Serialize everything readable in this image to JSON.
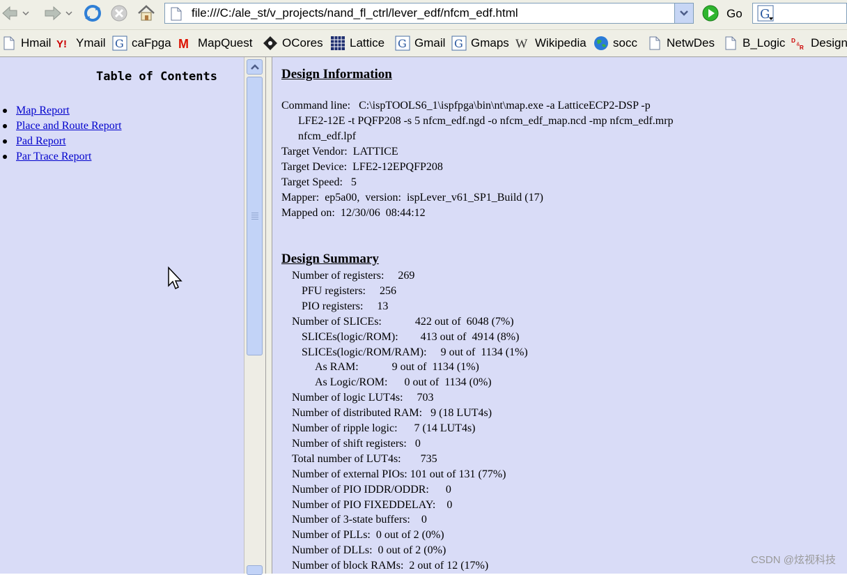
{
  "toolbar": {
    "address": "file:///C:/ale_st/v_projects/nand_fl_ctrl/lever_edf/nfcm_edf.html",
    "go_label": "Go",
    "icons": [
      "back-icon",
      "forward-icon",
      "reload-icon",
      "stop-icon",
      "home-icon",
      "page-icon",
      "go-icon",
      "google-search-icon"
    ]
  },
  "bookmarks": [
    {
      "label": "Hmail",
      "icon": "page-icon"
    },
    {
      "label": "Ymail",
      "icon": "yahoo-icon"
    },
    {
      "label": "caFpga",
      "icon": "google-icon"
    },
    {
      "label": "MapQuest",
      "icon": "mapquest-icon"
    },
    {
      "label": "OCores",
      "icon": "opencores-icon"
    },
    {
      "label": "Lattice",
      "icon": "lattice-icon"
    },
    {
      "label": "Gmail",
      "icon": "google-icon"
    },
    {
      "label": "Gmaps",
      "icon": "google-icon"
    },
    {
      "label": "Wikipedia",
      "icon": "wikipedia-icon"
    },
    {
      "label": "socc",
      "icon": "globe-icon"
    },
    {
      "label": "NetwDes",
      "icon": "page-icon"
    },
    {
      "label": "B_Logic",
      "icon": "page-icon"
    },
    {
      "label": "Design",
      "icon": "dr-icon"
    }
  ],
  "toc": {
    "title": "Table of Contents",
    "items": [
      "Map Report",
      "Place and Route Report",
      "Pad Report",
      "Par Trace Report"
    ]
  },
  "design_info": {
    "heading": "Design Information",
    "command_line": [
      "Command line:   C:\\ispTOOLS6_1\\ispfpga\\bin\\nt\\map.exe -a LatticeECP2-DSP -p",
      "LFE2-12E -t PQFP208 -s 5 nfcm_edf.ngd -o nfcm_edf_map.ncd -mp nfcm_edf.mrp",
      "nfcm_edf.lpf"
    ],
    "lines": [
      "Target Vendor:  LATTICE",
      "Target Device:  LFE2-12EPQFP208",
      "Target Speed:   5",
      "Mapper:  ep5a00,  version:  ispLever_v61_SP1_Build (17)",
      "Mapped on:  12/30/06  08:44:12"
    ]
  },
  "design_summary": {
    "heading": "Design Summary",
    "rows": [
      {
        "indent": 0,
        "text": "Number of registers:     269"
      },
      {
        "indent": 1,
        "text": "PFU registers:     256"
      },
      {
        "indent": 1,
        "text": "PIO registers:     13"
      },
      {
        "indent": 0,
        "text": "Number of SLICEs:            422 out of  6048 (7%)"
      },
      {
        "indent": 1,
        "text": "SLICEs(logic/ROM):        413 out of  4914 (8%)"
      },
      {
        "indent": 1,
        "text": "SLICEs(logic/ROM/RAM):     9 out of  1134 (1%)"
      },
      {
        "indent": 2,
        "text": "As RAM:            9 out of  1134 (1%)"
      },
      {
        "indent": 2,
        "text": "As Logic/ROM:      0 out of  1134 (0%)"
      },
      {
        "indent": 0,
        "text": "Number of logic LUT4s:     703"
      },
      {
        "indent": 0,
        "text": "Number of distributed RAM:   9 (18 LUT4s)"
      },
      {
        "indent": 0,
        "text": "Number of ripple logic:      7 (14 LUT4s)"
      },
      {
        "indent": 0,
        "text": "Number of shift registers:   0"
      },
      {
        "indent": 0,
        "text": "Total number of LUT4s:       735"
      },
      {
        "indent": 0,
        "text": "Number of external PIOs: 101 out of 131 (77%)"
      },
      {
        "indent": 0,
        "text": "Number of PIO IDDR/ODDR:      0"
      },
      {
        "indent": 0,
        "text": "Number of PIO FIXEDDELAY:    0"
      },
      {
        "indent": 0,
        "text": "Number of 3-state buffers:    0"
      },
      {
        "indent": 0,
        "text": "Number of PLLs:  0 out of 2 (0%)"
      },
      {
        "indent": 0,
        "text": "Number of DLLs:  0 out of 2 (0%)"
      },
      {
        "indent": 0,
        "text": "Number of block RAMs:  2 out of 12 (17%)"
      }
    ]
  },
  "watermark": "CSDN @炫视科技"
}
